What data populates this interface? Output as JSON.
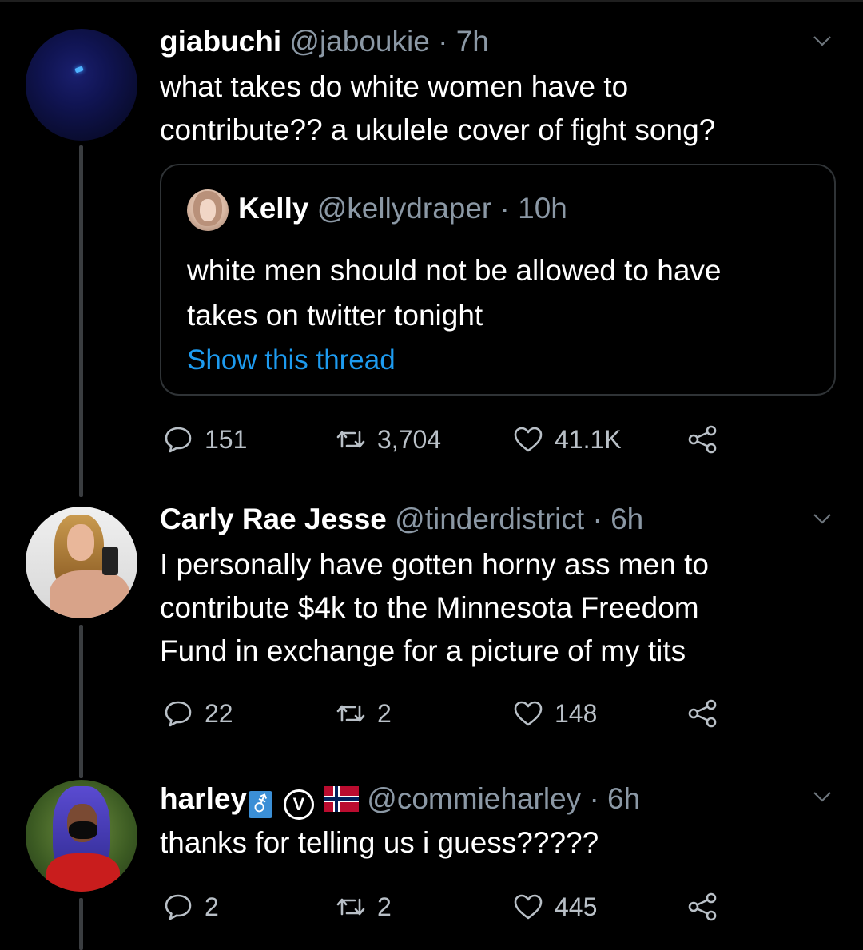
{
  "tweets": [
    {
      "display_name": "giabuchi",
      "handle": "@jaboukie",
      "separator": "·",
      "time": "7h",
      "text_lines": [
        "what takes do white women have to",
        "contribute?? a ukulele cover of fight song?"
      ],
      "quote": {
        "display_name": "Kelly",
        "handle": "@kellydraper",
        "separator": "·",
        "time": "10h",
        "text_lines": [
          "white men should not be allowed to have",
          "takes on twitter tonight"
        ],
        "link": "Show this thread"
      },
      "replies": "151",
      "retweets": "3,704",
      "likes": "41.1K"
    },
    {
      "display_name": "Carly Rae Jesse",
      "handle": "@tinderdistrict",
      "separator": "·",
      "time": "6h",
      "text_lines": [
        "I personally have gotten horny ass men to",
        "contribute $4k to the Minnesota Freedom",
        "Fund in exchange for a picture of my tits"
      ],
      "replies": "22",
      "retweets": "2",
      "likes": "148"
    },
    {
      "display_name": "harley",
      "badge_glyph": "⚦",
      "circle_letter": "V",
      "handle": "@commieharley",
      "separator": "·",
      "time": "6h",
      "text_lines": [
        "thanks for telling us i guess?????"
      ],
      "replies": "2",
      "retweets": "2",
      "likes": "445"
    }
  ],
  "icons": {
    "reply": "reply-icon",
    "retweet": "retweet-icon",
    "like": "heart-icon",
    "share": "share-icon",
    "menu": "chevron-down-icon"
  },
  "colors": {
    "background": "#000000",
    "text": "#ffffff",
    "muted": "#8b98a5",
    "link": "#1d9bf0",
    "thread_line": "#3a3d40"
  }
}
